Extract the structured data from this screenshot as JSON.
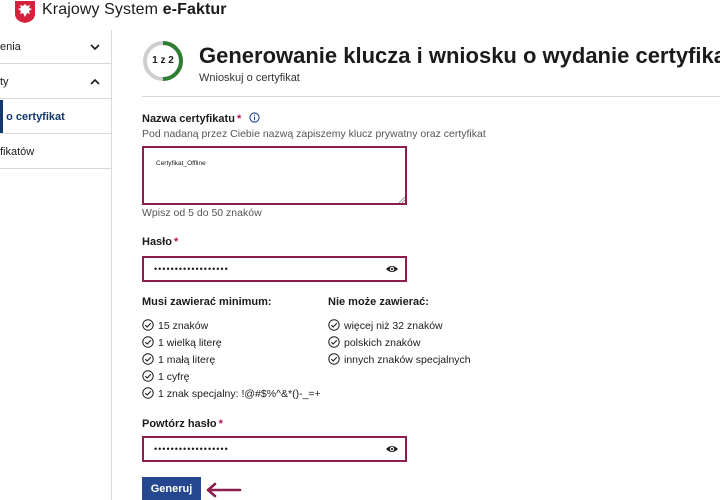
{
  "header": {
    "brand_prefix": "Krajowy System ",
    "brand_e": "e",
    "brand_suffix": "-Faktur"
  },
  "sidebar": {
    "items": [
      {
        "label": "enia",
        "chevron": "down"
      },
      {
        "label": "ty",
        "chevron": "up"
      },
      {
        "label": "j o certyfikat",
        "active": true
      },
      {
        "label": "fikatów"
      }
    ]
  },
  "step": {
    "label": "1 z 2",
    "progress": 0.5
  },
  "page": {
    "title": "Generowanie klucza i wniosku o wydanie certyfikat",
    "subtitle": "Wnioskuj o certyfikat"
  },
  "cert_name": {
    "label": "Nazwa certyfikatu",
    "required_mark": "*",
    "hint": "Pod nadaną przez Ciebie nazwą zapiszemy klucz prywatny oraz certyfikat",
    "value": "Certyfikat_Offline",
    "length_hint": "Wpisz od 5 do 50 znaków"
  },
  "password": {
    "label": "Hasło",
    "required_mark": "*",
    "value": "••••••••••••••••••"
  },
  "rules": {
    "must_title": "Musi zawierać minimum:",
    "must": [
      "15 znaków",
      "1 wielką literę",
      "1 małą literę",
      "1 cyfrę",
      "1 znak specjalny: !@#$%^&*()-_=+"
    ],
    "mustnot_title": "Nie może zawierać:",
    "mustnot": [
      "więcej niż 32 znaków",
      "polskich znaków",
      "innych znaków specjalnych"
    ]
  },
  "password_repeat": {
    "label": "Powtórz hasło",
    "required_mark": "*",
    "value": "••••••••••••••••••"
  },
  "actions": {
    "generate_label": "Generuj"
  },
  "colors": {
    "accent": "#8c1d4d",
    "primary": "#24478f",
    "progress": "#2e7d32",
    "nav_active": "#14386b"
  }
}
